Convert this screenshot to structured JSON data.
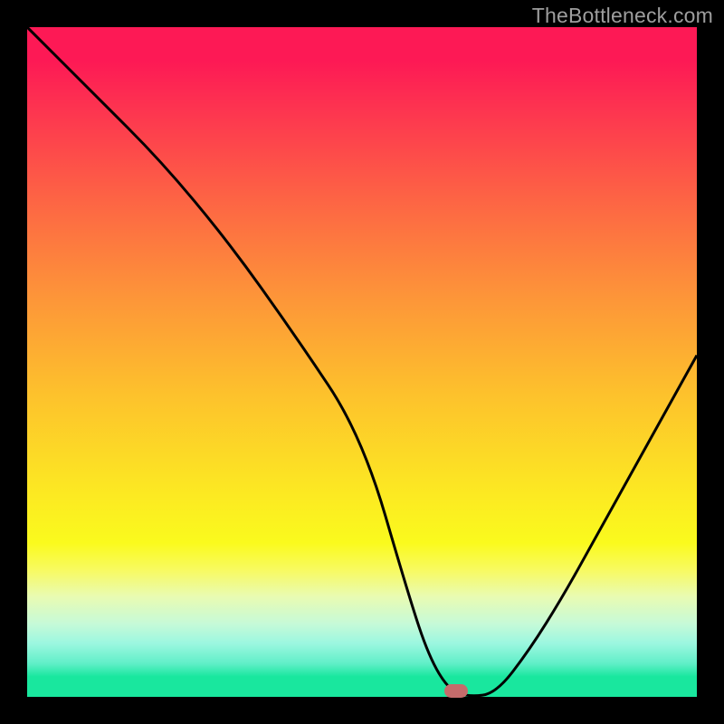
{
  "attribution": "TheBottleneck.com",
  "colors": {
    "marker": "#c56b6b",
    "curve": "#000000",
    "frame": "#000000"
  },
  "chart_data": {
    "type": "line",
    "title": "",
    "xlabel": "",
    "ylabel": "",
    "xlim": [
      0,
      100
    ],
    "ylim": [
      0,
      100
    ],
    "x": [
      0,
      10,
      20,
      30,
      40,
      50,
      57,
      60,
      63,
      66,
      70,
      75,
      80,
      85,
      90,
      95,
      100
    ],
    "values": [
      100,
      90,
      80,
      68,
      54,
      39,
      15,
      6,
      1,
      0,
      0.5,
      7,
      15,
      24,
      33,
      42,
      51
    ],
    "notes": "V-shaped bottleneck curve with minimum around x≈65; values are approximate percent read from the chart."
  },
  "marker": {
    "x_pct": 64,
    "y_pct": 99
  }
}
